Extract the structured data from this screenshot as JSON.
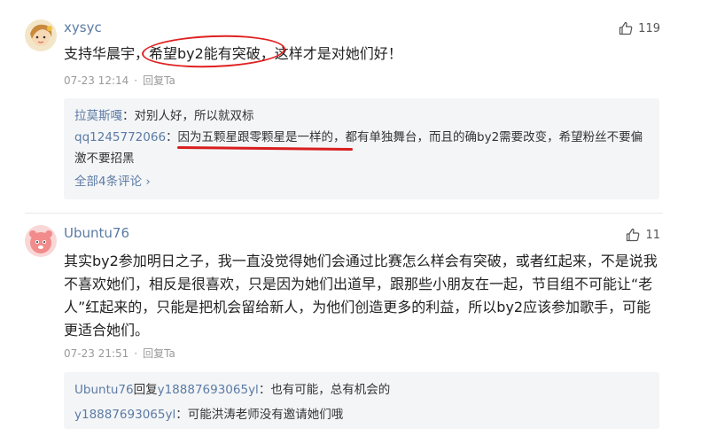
{
  "comments": [
    {
      "username": "xysyc",
      "likes": "119",
      "text": "支持华晨宇，希望by2能有突破，这样才是对她们好！",
      "date": "07-23 12:14",
      "reply_label": "回复Ta",
      "replies": [
        {
          "name": "拉莫斯嘎",
          "sep": "：",
          "text": "对别人好，所以就双标"
        },
        {
          "name": "qq1245772066",
          "sep": "：",
          "text": "因为五颗星跟零颗星是一样的，都有单独舞台，而且的确by2需要改变，希望粉丝不要偏激不要招黑"
        }
      ],
      "all_replies": "全部4条评论 ›"
    },
    {
      "username": "Ubuntu76",
      "likes": "11",
      "text": "其实by2参加明日之子，我一直没觉得她们会通过比赛怎么样会有突破，或者红起来，不是说我不喜欢她们，相反是很喜欢，只是因为她们出道早，跟那些小朋友在一起，节目组不可能让“老人”红起来的，只能是把机会留给新人，为他们创造更多的利益，所以by2应该参加歌手，可能更适合她们。",
      "date": "07-23 21:51",
      "reply_label": "回复Ta",
      "replies": [
        {
          "name": "Ubuntu76",
          "mid": "回复",
          "target": "y18887693065yl",
          "sep": "：",
          "text": "也有可能，总有机会的"
        },
        {
          "name": "y18887693065yl",
          "sep": "：",
          "text": "可能洪涛老师没有邀请她们哦"
        }
      ]
    }
  ],
  "colors": {
    "link": "#5b7ba4",
    "annotation_red": "#e02020",
    "reply_bg": "#f4f5f7"
  },
  "icons": {
    "like": "thumbs-up-icon",
    "chevron": "chevron-right-icon"
  }
}
